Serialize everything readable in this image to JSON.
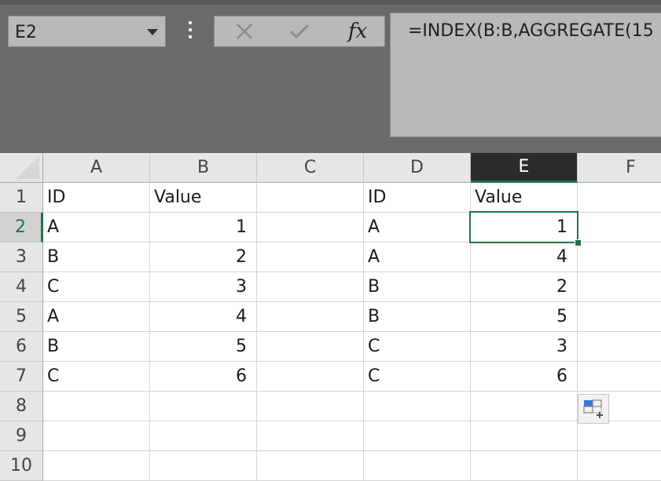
{
  "name_box": {
    "value": "E2"
  },
  "formula_bar": {
    "cancel_icon": "x-icon",
    "enter_icon": "check-icon",
    "fx_label": "fx",
    "formula": "=INDEX(B:B,AGGREGATE(15"
  },
  "columns": [
    "A",
    "B",
    "C",
    "D",
    "E",
    "F"
  ],
  "rows": [
    "1",
    "2",
    "3",
    "4",
    "5",
    "6",
    "7",
    "8",
    "9",
    "10"
  ],
  "selected": {
    "column": "E",
    "row": "2"
  },
  "cells": {
    "A": [
      "ID",
      "A",
      "B",
      "C",
      "A",
      "B",
      "C",
      "",
      "",
      ""
    ],
    "B": [
      "Value",
      "1",
      "2",
      "3",
      "4",
      "5",
      "6",
      "",
      "",
      ""
    ],
    "C": [
      "",
      "",
      "",
      "",
      "",
      "",
      "",
      "",
      "",
      ""
    ],
    "D": [
      "ID",
      "A",
      "A",
      "B",
      "B",
      "C",
      "C",
      "",
      "",
      ""
    ],
    "E": [
      "Value",
      "1",
      "4",
      "2",
      "5",
      "3",
      "6",
      "",
      "",
      ""
    ],
    "F": [
      "",
      "",
      "",
      "",
      "",
      "",
      "",
      "",
      "",
      ""
    ]
  },
  "colors": {
    "accent": "#217346",
    "ribbon": "#6a6a6a",
    "header_bg": "#e6e6e6"
  }
}
